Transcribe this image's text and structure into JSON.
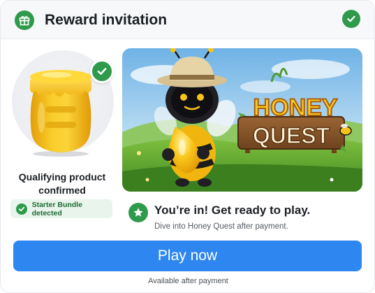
{
  "header": {
    "title": "Reward invitation",
    "gift_icon": "gift-icon",
    "status_icon": "check-circle-icon"
  },
  "product": {
    "image_icon": "honey-jar-icon",
    "status_icon": "check-circle-icon",
    "label": "Qualifying product confirmed",
    "badge_text": "Starter Bundle detected"
  },
  "banner": {
    "title_line1": "HONEY",
    "title_line2": "QUEST"
  },
  "confirmation": {
    "icon": "star-icon",
    "headline": "You’re in! Get ready to play.",
    "subline": "Dive into Honey Quest after payment."
  },
  "cta": {
    "label": "Play now",
    "footnote": "Available after payment"
  },
  "colors": {
    "accent_green": "#2f9a4c",
    "button_blue": "#2e86f0",
    "honey_yellow": "#f6c21c"
  }
}
